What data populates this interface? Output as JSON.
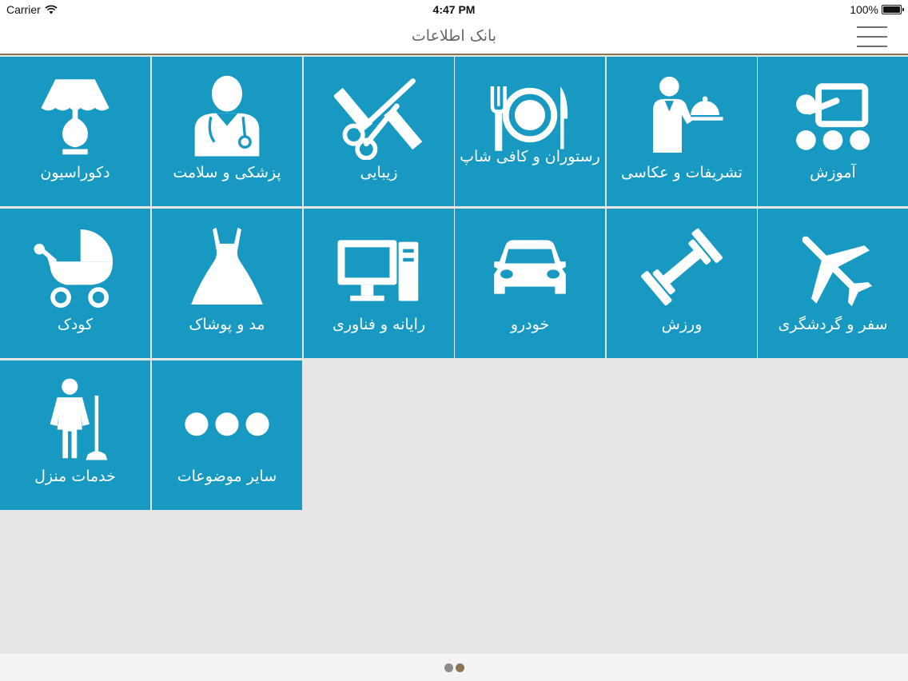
{
  "status_bar": {
    "carrier": "Carrier",
    "time": "4:47 PM",
    "battery": "100%"
  },
  "nav": {
    "title": "بانک اطلاعات"
  },
  "tiles": [
    {
      "label": "آموزش",
      "icon": "classroom-icon"
    },
    {
      "label": "تشریفات و عکاسی",
      "icon": "waiter-icon"
    },
    {
      "label": "رستوران و کافی شاپ",
      "icon": "plate-fork-knife-icon"
    },
    {
      "label": "زیبایی",
      "icon": "scissors-comb-icon"
    },
    {
      "label": "پزشکی و سلامت",
      "icon": "doctor-icon"
    },
    {
      "label": "دکوراسیون",
      "icon": "lamp-icon"
    },
    {
      "label": "سفر و گردشگری",
      "icon": "airplane-icon"
    },
    {
      "label": "ورزش",
      "icon": "dumbbell-icon"
    },
    {
      "label": "خودرو",
      "icon": "car-icon"
    },
    {
      "label": "رایانه و فناوری",
      "icon": "computer-icon"
    },
    {
      "label": "مد و پوشاک",
      "icon": "dress-icon"
    },
    {
      "label": "کودک",
      "icon": "stroller-icon"
    },
    {
      "label": "سایر موضوعات",
      "icon": "more-dots-icon"
    },
    {
      "label": "خدمات منزل",
      "icon": "housekeeper-icon"
    }
  ],
  "pagination": {
    "page_count": 2,
    "current_page": 2
  },
  "colors": {
    "tile_bg": "#1799c1",
    "nav_border": "#8a7650",
    "dot_inactive": "#8c8c8c",
    "dot_active": "#8a7650"
  }
}
